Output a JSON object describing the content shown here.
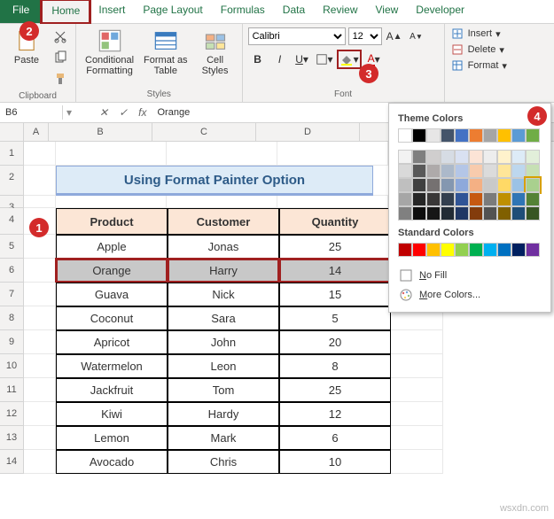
{
  "tabs": [
    "File",
    "Home",
    "Insert",
    "Page Layout",
    "Formulas",
    "Data",
    "Review",
    "View",
    "Developer"
  ],
  "ribbon": {
    "clipboard": {
      "label": "Clipboard",
      "paste": "Paste"
    },
    "styles": {
      "label": "Styles",
      "cond": "Conditional\nFormatting",
      "table": "Format as\nTable",
      "cell": "Cell\nStyles"
    },
    "font": {
      "label": "Font",
      "name": "Calibri",
      "size": "12"
    },
    "cells": {
      "insert": "Insert",
      "delete": "Delete",
      "format": "Format"
    }
  },
  "namebox": "B6",
  "formula": "Orange",
  "cols": [
    "A",
    "B",
    "C",
    "D"
  ],
  "title": "Using Format Painter Option",
  "headers": [
    "Product",
    "Customer",
    "Quantity"
  ],
  "rows": [
    {
      "n": 5,
      "p": "Apple",
      "c": "Jonas",
      "q": "25"
    },
    {
      "n": 6,
      "p": "Orange",
      "c": "Harry",
      "q": "14",
      "sel": true
    },
    {
      "n": 7,
      "p": "Guava",
      "c": "Nick",
      "q": "15"
    },
    {
      "n": 8,
      "p": "Coconut",
      "c": "Sara",
      "q": "5"
    },
    {
      "n": 9,
      "p": "Apricot",
      "c": "John",
      "q": "20"
    },
    {
      "n": 10,
      "p": "Watermelon",
      "c": "Leon",
      "q": "8"
    },
    {
      "n": 11,
      "p": "Jackfruit",
      "c": "Tom",
      "q": "25"
    },
    {
      "n": 12,
      "p": "Kiwi",
      "c": "Hardy",
      "q": "12"
    },
    {
      "n": 13,
      "p": "Lemon",
      "c": "Mark",
      "q": "6"
    },
    {
      "n": 14,
      "p": "Avocado",
      "c": "Chris",
      "q": "10"
    }
  ],
  "dropdown": {
    "theme": "Theme Colors",
    "standard": "Standard Colors",
    "nofill": "No Fill",
    "more": "More Colors...",
    "themeColors": [
      "#ffffff",
      "#000000",
      "#e7e6e6",
      "#44546a",
      "#4472c4",
      "#ed7d31",
      "#a5a5a5",
      "#ffc000",
      "#5b9bd5",
      "#70ad47"
    ],
    "themeShades": [
      [
        "#f2f2f2",
        "#7f7f7f",
        "#d0cece",
        "#d6dce4",
        "#d9e1f2",
        "#fce4d6",
        "#ededed",
        "#fff2cc",
        "#ddebf7",
        "#e2efda"
      ],
      [
        "#d9d9d9",
        "#595959",
        "#aeaaaa",
        "#acb9ca",
        "#b4c6e7",
        "#f8cbad",
        "#dbdbdb",
        "#ffe699",
        "#bdd7ee",
        "#c6e0b4"
      ],
      [
        "#bfbfbf",
        "#404040",
        "#757171",
        "#8497b0",
        "#8ea9db",
        "#f4b084",
        "#c9c9c9",
        "#ffd966",
        "#9bc2e6",
        "#a9d08e"
      ],
      [
        "#a6a6a6",
        "#262626",
        "#3a3838",
        "#333f4f",
        "#305496",
        "#c65911",
        "#7b7b7b",
        "#bf8f00",
        "#2f75b5",
        "#548235"
      ],
      [
        "#808080",
        "#0d0d0d",
        "#161616",
        "#222b35",
        "#203764",
        "#833c0c",
        "#525252",
        "#806000",
        "#1f4e78",
        "#375623"
      ]
    ],
    "stdColors": [
      "#c00000",
      "#ff0000",
      "#ffc000",
      "#ffff00",
      "#92d050",
      "#00b050",
      "#00b0f0",
      "#0070c0",
      "#002060",
      "#7030a0"
    ]
  },
  "watermark": "wsxdn.com",
  "chart_data": {
    "type": "table",
    "title": "Using Format Painter Option",
    "columns": [
      "Product",
      "Customer",
      "Quantity"
    ],
    "rows": [
      [
        "Apple",
        "Jonas",
        25
      ],
      [
        "Orange",
        "Harry",
        14
      ],
      [
        "Guava",
        "Nick",
        15
      ],
      [
        "Coconut",
        "Sara",
        5
      ],
      [
        "Apricot",
        "John",
        20
      ],
      [
        "Watermelon",
        "Leon",
        8
      ],
      [
        "Jackfruit",
        "Tom",
        25
      ],
      [
        "Kiwi",
        "Hardy",
        12
      ],
      [
        "Lemon",
        "Mark",
        6
      ],
      [
        "Avocado",
        "Chris",
        10
      ]
    ]
  }
}
